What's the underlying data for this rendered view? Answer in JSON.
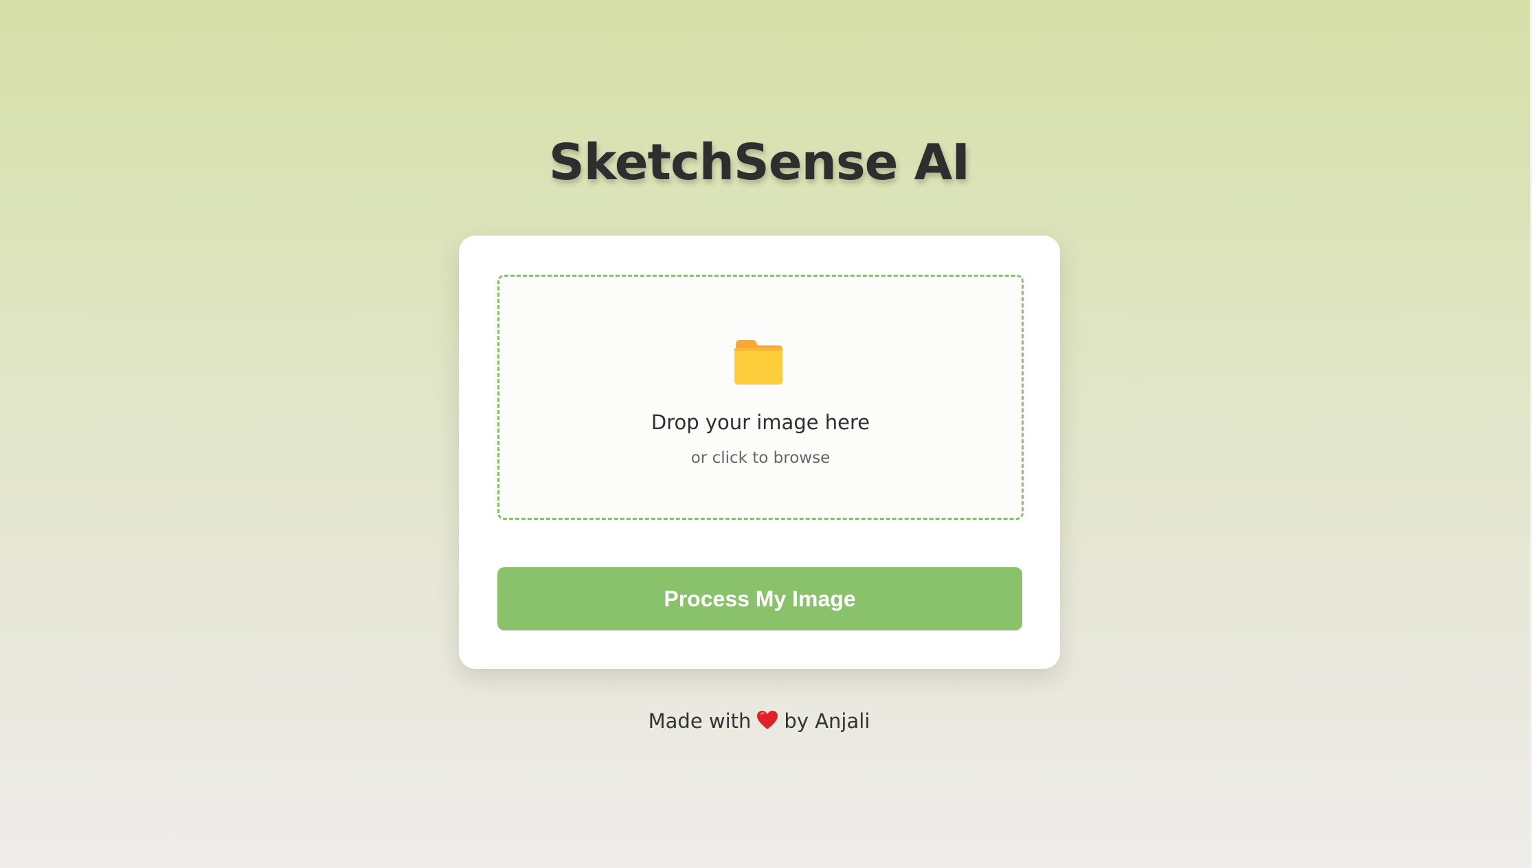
{
  "header": {
    "title": "SketchSense AI"
  },
  "upload": {
    "icon": "folder-icon",
    "title": "Drop your image here",
    "subtitle": "or click to browse"
  },
  "actions": {
    "process_label": "Process My Image"
  },
  "footer": {
    "prefix": "Made with",
    "icon": "heart-icon",
    "suffix": "by Anjali"
  },
  "colors": {
    "accent": "#89c26a",
    "dropzone_border": "#86c16a",
    "title": "#2e2e2e",
    "heart": "#e0202a",
    "folder": "#fcc935"
  }
}
